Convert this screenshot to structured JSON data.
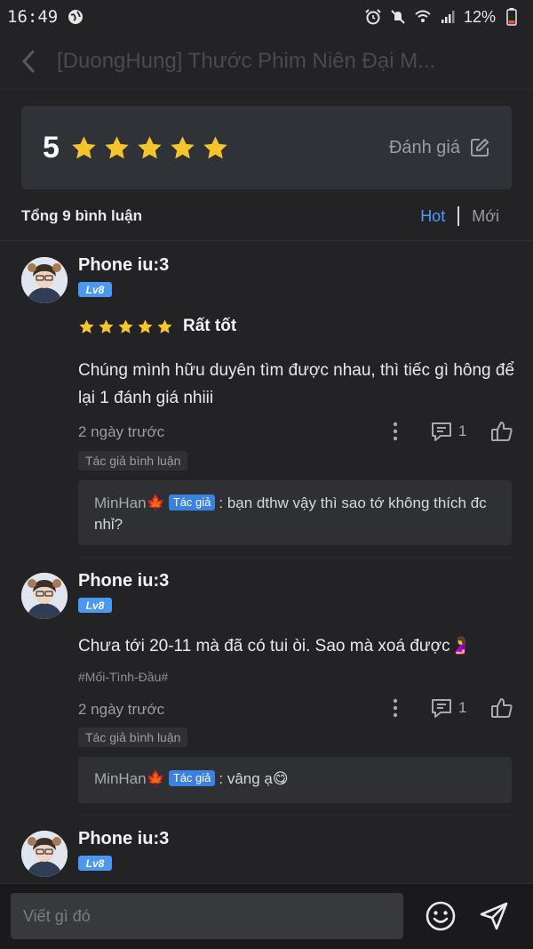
{
  "status_bar": {
    "time": "16:49",
    "battery": "12%",
    "icons": [
      "globe-icon",
      "alarm-icon",
      "mute-icon",
      "wifi-icon",
      "signal-icon",
      "battery-icon"
    ]
  },
  "header": {
    "title": "[DuongHung] Thước Phim Niên Đại M...",
    "back_icon": "chevron-left-icon"
  },
  "rating_summary": {
    "score": "5",
    "stars": 5,
    "rate_label": "Đánh giá",
    "rate_icon": "edit-icon"
  },
  "comments_header": {
    "total": "Tổng 9 bình luận",
    "sort_hot": "Hot",
    "sort_new": "Mới"
  },
  "comments": [
    {
      "username": "Phone iu:3",
      "level": "Lv8",
      "stars": 5,
      "rating_label": "Rất tốt",
      "text": "Chúng mình hữu duyên tìm được nhau, thì tiếc gì hông để lại 1 đánh giá nhiii",
      "time": "2 ngày trước",
      "reply_count": "1",
      "author_tag": "Tác giả bình luận",
      "reply": {
        "name": "MinHan🍁",
        "badge": "Tác giả",
        "text": ": bạn dthw vậy thì sao tớ không thích đc nhỉ?"
      }
    },
    {
      "username": "Phone iu:3",
      "level": "Lv8",
      "text": "Chưa tới 20-11 mà đã có tui òi. Sao mà xoá được🤰",
      "hashtag": "#Mối-Tình-Đầu#",
      "time": "2 ngày trước",
      "reply_count": "1",
      "author_tag": "Tác giả bình luận",
      "reply": {
        "name": "MinHan🍁",
        "badge": "Tác giả",
        "text": ": vâng ạ😋"
      }
    },
    {
      "username": "Phone iu:3",
      "level": "Lv8"
    }
  ],
  "composer": {
    "placeholder": "Viết gì đó",
    "emoji_icon": "smile-icon",
    "send_icon": "send-icon"
  },
  "colors": {
    "background": "#232325",
    "accent": "#4d9bff",
    "star": "#f7c52b",
    "badge": "#4a98f0"
  }
}
